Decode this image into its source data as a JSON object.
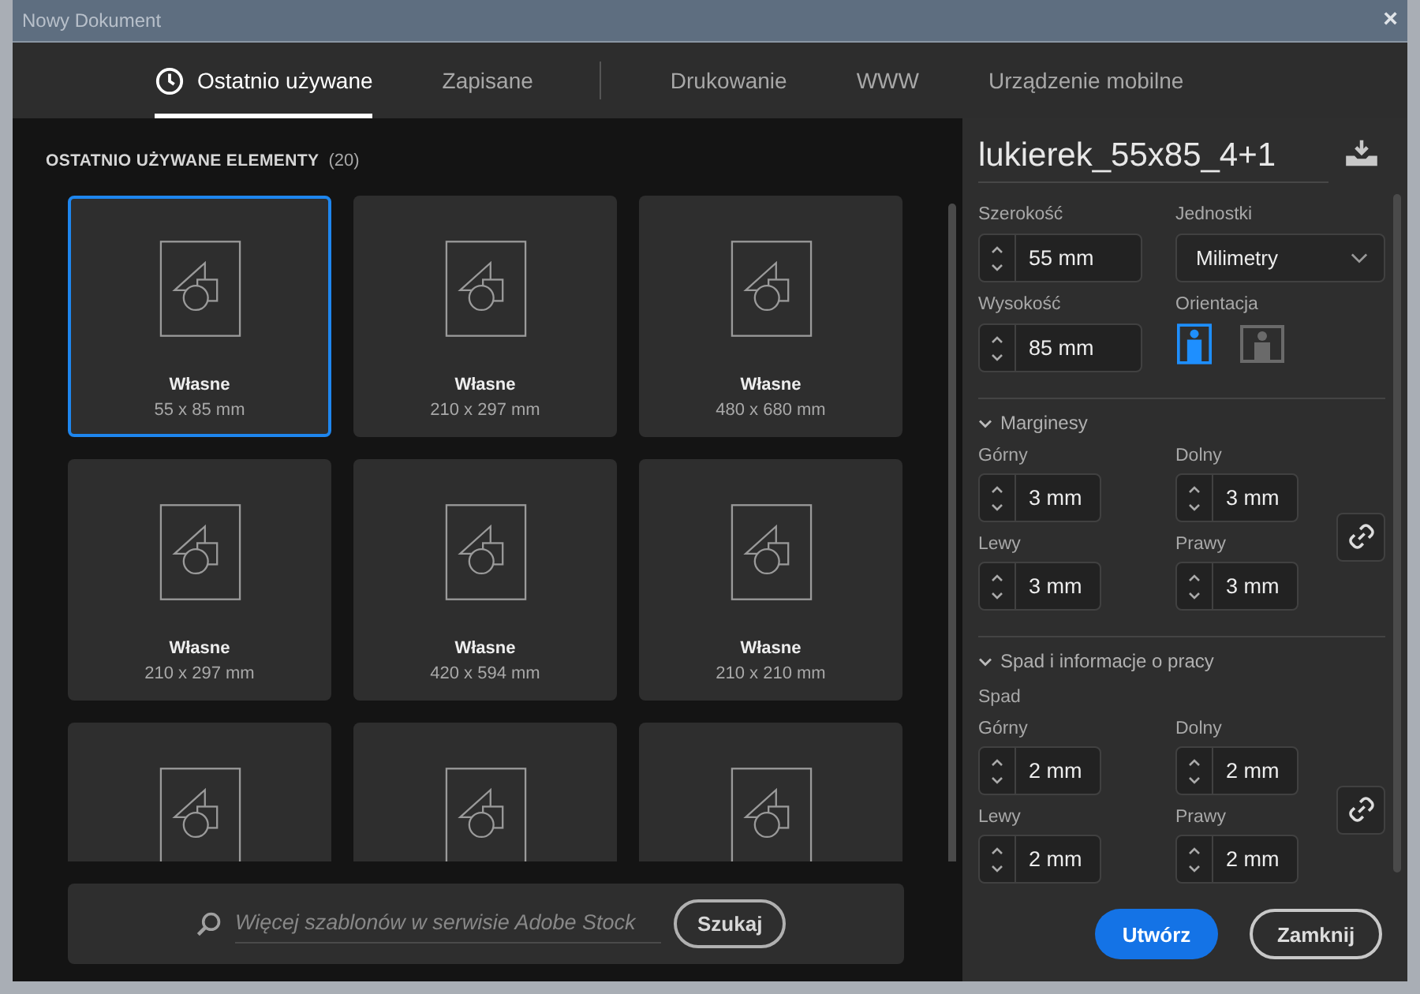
{
  "window": {
    "title": "Nowy Dokument",
    "close": "×"
  },
  "tabs": [
    {
      "label": "Ostatnio używane",
      "selected": true,
      "kind": "history"
    },
    {
      "label": "Zapisane",
      "selected": false,
      "kind": "plain"
    },
    {
      "label": "Drukowanie",
      "selected": false,
      "kind": "plain"
    },
    {
      "label": "WWW",
      "selected": false,
      "kind": "plain"
    },
    {
      "label": "Urządzenie mobilne",
      "selected": false,
      "kind": "plain"
    }
  ],
  "recent": {
    "heading": "OSTATNIO UŻYWANE ELEMENTY",
    "count": "(20)",
    "cards": [
      {
        "name": "Własne",
        "size": "55 x 85 mm",
        "selected": true
      },
      {
        "name": "Własne",
        "size": "210 x 297 mm",
        "selected": false
      },
      {
        "name": "Własne",
        "size": "480 x 680 mm",
        "selected": false
      },
      {
        "name": "Własne",
        "size": "210 x 297 mm",
        "selected": false
      },
      {
        "name": "Własne",
        "size": "420 x 594 mm",
        "selected": false
      },
      {
        "name": "Własne",
        "size": "210 x 210 mm",
        "selected": false
      },
      {
        "selected": false
      },
      {
        "selected": false
      },
      {
        "selected": false
      }
    ]
  },
  "stock_search": {
    "placeholder": "Więcej szablonów w serwisie Adobe Stock",
    "button": "Szukaj"
  },
  "details": {
    "document_name": "lukierek_55x85_4+1",
    "width": {
      "label": "Szerokość",
      "value": "55 mm"
    },
    "units": {
      "label": "Jednostki",
      "value": "Milimetry"
    },
    "height": {
      "label": "Wysokość",
      "value": "85 mm"
    },
    "orientation": {
      "label": "Orientacja",
      "options": [
        {
          "kind": "portrait",
          "selected": true
        },
        {
          "kind": "landscape",
          "selected": false
        }
      ]
    },
    "sections": [
      {
        "title": "Marginesy",
        "expanded": true,
        "fields": [
          {
            "label": "Górny",
            "value": "3 mm"
          },
          {
            "label": "Dolny",
            "value": "3 mm"
          },
          {
            "label": "Lewy",
            "value": "3 mm"
          },
          {
            "label": "Prawy",
            "value": "3 mm"
          }
        ]
      },
      {
        "title": "Spad i informacje o pracy",
        "expanded": true,
        "subtitle": "Spad",
        "fields": [
          {
            "label": "Górny",
            "value": "2 mm"
          },
          {
            "label": "Dolny",
            "value": "2 mm"
          },
          {
            "label": "Lewy",
            "value": "2 mm"
          },
          {
            "label": "Prawy",
            "value": "2 mm"
          }
        ]
      }
    ]
  },
  "buttons": [
    {
      "label": "Utwórz",
      "kind": "primary"
    },
    {
      "label": "Zamknij",
      "kind": "secondary"
    }
  ]
}
